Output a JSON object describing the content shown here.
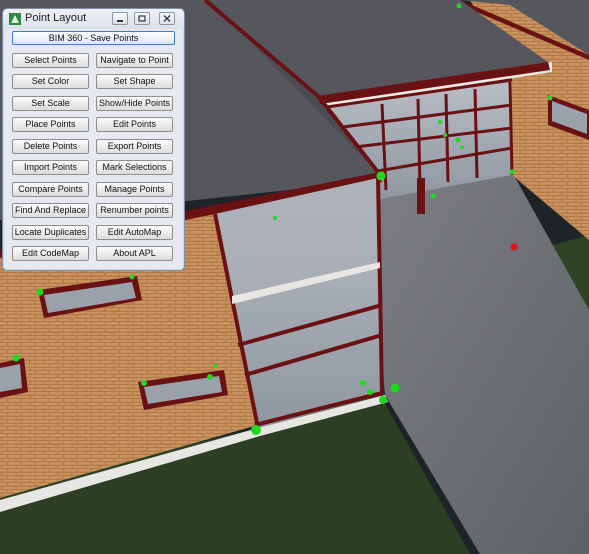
{
  "window": {
    "title": "Point Layout",
    "icons": [
      "app-icon",
      "minimize-icon",
      "restore-icon",
      "close-icon"
    ]
  },
  "primary_button": "BIM 360 - Save Points",
  "buttons": [
    [
      "Select Points",
      "Navigate to Point"
    ],
    [
      "Set Color",
      "Set Shape"
    ],
    [
      "Set Scale",
      "Show/Hide Points"
    ],
    [
      "Place Points",
      "Edit Points"
    ],
    [
      "Delete Points",
      "Export Points"
    ],
    [
      "Import Points",
      "Mark Selections"
    ],
    [
      "Compare Points",
      "Manage  Points"
    ],
    [
      "Find And Replace",
      "Renumber points"
    ],
    [
      "Locate Duplicates",
      "Edit AutoMap"
    ],
    [
      "Edit CodeMap",
      "About APL"
    ]
  ],
  "colors": {
    "point_marker": "#1fd81f",
    "selected_point": "#e01414",
    "brick": "#c9925f",
    "roof": "#55575d",
    "frame": "#6a1114",
    "window_accent": "#3d7bd1"
  }
}
